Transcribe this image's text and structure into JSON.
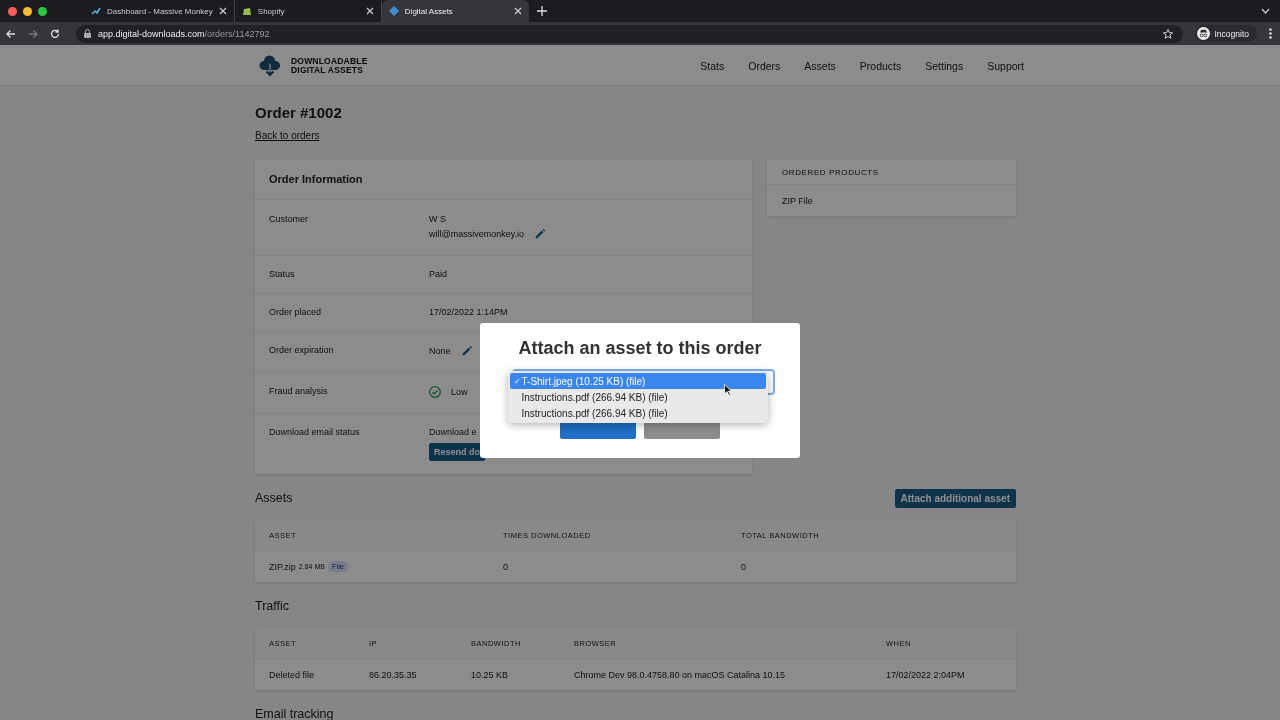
{
  "browser": {
    "tabs": [
      {
        "title": "Dashboard - Massive Monkey",
        "selected": false
      },
      {
        "title": "Shopify",
        "selected": false
      },
      {
        "title": "Digital Assets",
        "selected": true
      }
    ],
    "url_host": "app.digital-downloads.com",
    "url_path": "/orders/1142792",
    "profile": "Incognito"
  },
  "header": {
    "brand": [
      "DOWNLOADABLE",
      "DIGITAL ASSETS"
    ],
    "nav": [
      "Stats",
      "Orders",
      "Assets",
      "Products",
      "Settings",
      "Support"
    ]
  },
  "order": {
    "title": "Order #1002",
    "back_link": "Back to orders",
    "info": {
      "title": "Order Information",
      "rows": [
        {
          "label": "Customer",
          "kind": "edit",
          "lines": [
            "W S",
            "will@massivemonkey.io"
          ]
        },
        {
          "label": "Status",
          "kind": "plain",
          "lines": [
            "Paid"
          ]
        },
        {
          "label": "Order placed",
          "kind": "plain",
          "lines": [
            "17/02/2022 1:14PM"
          ]
        },
        {
          "label": "Order expiration",
          "kind": "edit",
          "lines": [
            "None"
          ]
        },
        {
          "label": "Fraud analysis",
          "kind": "check",
          "lines": [
            "Low"
          ]
        },
        {
          "label": "Download email status",
          "kind": "action",
          "lines": [
            "Download e"
          ],
          "button": "Resend do"
        }
      ]
    },
    "ordered_products": {
      "title": "ORDERED PRODUCTS",
      "items": [
        "ZIP File"
      ]
    }
  },
  "assets": {
    "title": "Assets",
    "button": "Attach additional asset",
    "columns": [
      "ASSET",
      "TIMES DOWNLOADED",
      "TOTAL BANDWIDTH"
    ],
    "rows": [
      {
        "name": "ZIP.zip",
        "size": "2.84 MB",
        "badge": "File",
        "times_downloaded": "0",
        "total_bandwidth": "0"
      }
    ]
  },
  "traffic": {
    "title": "Traffic",
    "columns": [
      "ASSET",
      "IP",
      "BANDWIDTH",
      "BROWSER",
      "WHEN"
    ],
    "rows": [
      [
        "Deleted file",
        "86.20.35.35",
        "10.25 KB",
        "Chrome Dev 98.0.4758.80 on macOS Catalina 10.15",
        "17/02/2022 2:04PM"
      ]
    ]
  },
  "email_tracking": {
    "title": "Email tracking"
  },
  "modal": {
    "title": "Attach an asset to this order",
    "check_mark": "✓",
    "options": [
      {
        "label": "T-Shirt.jpeg (10.25 KB) (file)",
        "selected": true
      },
      {
        "label": "Instructions.pdf (266.94 KB) (file)",
        "selected": false
      },
      {
        "label": "Instructions.pdf (266.94 KB) (file)",
        "selected": false
      }
    ]
  }
}
